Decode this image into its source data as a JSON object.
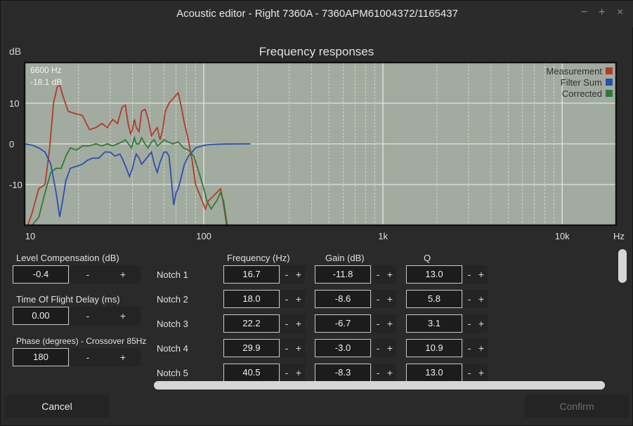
{
  "window": {
    "title": "Acoustic editor - Right 7360A - 7360APM61004372/1165437",
    "minimize_glyph": "−",
    "maximize_glyph": "+",
    "close_glyph": "×"
  },
  "chart_data": {
    "type": "line",
    "title": "Frequency responses",
    "ylabel": "dB",
    "xlabel": "Hz",
    "x_scale": "log",
    "xlim": [
      10,
      20000
    ],
    "ylim": [
      -20,
      20
    ],
    "x_ticks": [
      {
        "value": 10,
        "label": "10"
      },
      {
        "value": 100,
        "label": "100"
      },
      {
        "value": 1000,
        "label": "1k"
      },
      {
        "value": 10000,
        "label": "10k"
      }
    ],
    "y_ticks": [
      {
        "value": 10,
        "label": "10"
      },
      {
        "value": 0,
        "label": "0"
      },
      {
        "value": -10,
        "label": "-10"
      }
    ],
    "grid": true,
    "legend_position": "top-right",
    "cursor_readout": {
      "freq": "6600 Hz",
      "gain": "-18.1 dB"
    },
    "series": [
      {
        "name": "Measurement",
        "color": "#b23a2a",
        "x": [
          10.3,
          11,
          12,
          13,
          13.8,
          14.5,
          15.2,
          15.7,
          16.3,
          17.5,
          19,
          21,
          23,
          25,
          27,
          29,
          31,
          33,
          35,
          36.5,
          38,
          39,
          40,
          41,
          42,
          43.5,
          45,
          47,
          49,
          51,
          53,
          55,
          57,
          59,
          61,
          64,
          67,
          70,
          72,
          75,
          78,
          82,
          86,
          90,
          96,
          102,
          106,
          112,
          118,
          124,
          128,
          131,
          134,
          137
        ],
        "y": [
          -22,
          -17,
          -11,
          -10,
          -1,
          10,
          14,
          14.5,
          12,
          8,
          7.5,
          7,
          3.5,
          4,
          5,
          4,
          6,
          5,
          9,
          9.5,
          4.5,
          2.5,
          3.5,
          6,
          4,
          3,
          8,
          8.5,
          6,
          2,
          3,
          4,
          1,
          3.5,
          8,
          10,
          11,
          12,
          12.5,
          9,
          5,
          1,
          -4,
          -10,
          -13,
          -16,
          -14,
          -13,
          -12,
          -11,
          -14,
          -17,
          -20,
          -23
        ]
      },
      {
        "name": "Filter Sum",
        "color": "#2a4fb0",
        "x": [
          10,
          11,
          12,
          13,
          14,
          15,
          15.7,
          16.3,
          17,
          18,
          19.5,
          21,
          22.5,
          24,
          26,
          28,
          30,
          32,
          34,
          35,
          37,
          38.5,
          40,
          41,
          42,
          43.5,
          45,
          47,
          49,
          51,
          53,
          55,
          57,
          60,
          62,
          64,
          66,
          68,
          70,
          72,
          75,
          78,
          82,
          86,
          90,
          96,
          102,
          110,
          120,
          135,
          150,
          170,
          182
        ],
        "y": [
          0,
          -0.3,
          -1,
          -2,
          -5,
          -12,
          -18,
          -14,
          -9,
          -6,
          -5.5,
          -5,
          -4,
          -3.5,
          -3.5,
          -2,
          -2,
          -3,
          -2.5,
          -3.5,
          -6,
          -8,
          -6,
          -4,
          -2.5,
          -3.5,
          -5,
          -4,
          -3,
          -2,
          -5,
          -7,
          -4.5,
          -2,
          -2,
          -3,
          -9,
          -15,
          -12,
          -11,
          -8,
          -5,
          -3,
          -2,
          -1,
          -0.6,
          -0.3,
          -0.15,
          -0.08,
          -0.04,
          -0.02,
          0,
          0
        ]
      },
      {
        "name": "Corrected",
        "color": "#2f7a3a",
        "x": [
          10.3,
          11,
          12,
          13,
          14,
          15,
          16,
          17,
          18,
          19.5,
          21,
          23,
          25,
          27,
          29,
          31,
          33,
          35,
          36.5,
          38,
          39.5,
          41,
          42,
          43.5,
          45,
          47,
          49,
          51,
          53,
          55,
          57,
          60,
          63,
          67,
          72,
          77,
          82,
          88,
          94,
          100,
          104,
          110,
          118,
          124,
          129,
          133,
          136
        ],
        "y": [
          -22,
          -20,
          -18,
          -12,
          -7,
          -6,
          -6,
          -3,
          -1,
          -1.5,
          -0.5,
          -0.5,
          0,
          -0.5,
          0,
          -0.5,
          0,
          0.5,
          1,
          0,
          -1,
          1.5,
          0,
          0,
          1.5,
          0,
          -1,
          0.5,
          1,
          -0.5,
          0,
          1,
          0.5,
          0,
          0.5,
          -1,
          -1.5,
          -3,
          -7,
          -11,
          -14,
          -16,
          -14,
          -12,
          -14,
          -18,
          -23
        ]
      }
    ]
  },
  "controls": {
    "level_compensation": {
      "label": "Level Compensation (dB)",
      "value": "-0.4",
      "minus": "-",
      "plus": "+"
    },
    "time_of_flight": {
      "label": "Time Of Flight Delay (ms)",
      "value": "0.00",
      "minus": "-",
      "plus": "+"
    },
    "phase": {
      "label": "Phase (degrees) - Crossover 85Hz",
      "value": "180",
      "minus": "-",
      "plus": "+"
    }
  },
  "notch_table": {
    "headers": {
      "frequency": "Frequency (Hz)",
      "gain": "Gain (dB)",
      "q": "Q"
    },
    "minus": "-",
    "plus": "+",
    "rows": [
      {
        "label": "Notch 1",
        "frequency": "16.7",
        "gain": "-11.8",
        "q": "13.0"
      },
      {
        "label": "Notch 2",
        "frequency": "18.0",
        "gain": "-8.6",
        "q": "5.8"
      },
      {
        "label": "Notch 3",
        "frequency": "22.2",
        "gain": "-6.7",
        "q": "3.1"
      },
      {
        "label": "Notch 4",
        "frequency": "29.9",
        "gain": "-3.0",
        "q": "10.9"
      },
      {
        "label": "Notch 5",
        "frequency": "40.5",
        "gain": "-8.3",
        "q": "13.0"
      }
    ]
  },
  "buttons": {
    "cancel": "Cancel",
    "confirm": "Confirm"
  }
}
